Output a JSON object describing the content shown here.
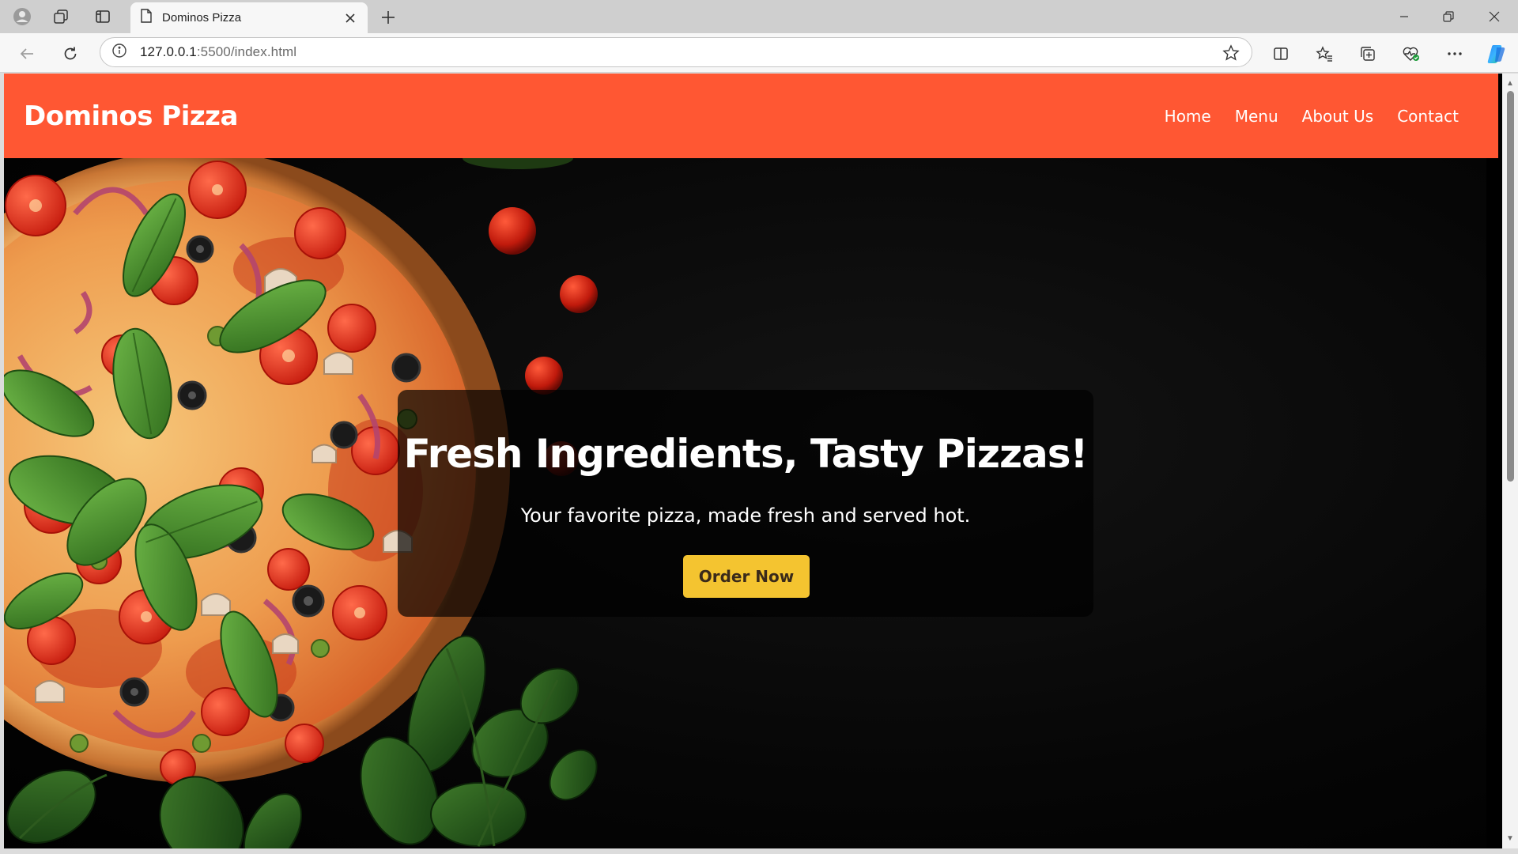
{
  "browser": {
    "tab_title": "Dominos Pizza",
    "url_host": "127.0.0.1",
    "url_rest": ":5500/index.html",
    "icons": {
      "profile": "profile-icon",
      "workspaces": "workspaces-icon",
      "tab_actions": "tab-actions-icon",
      "page": "page-icon",
      "close_tab": "close-icon",
      "new_tab": "plus-icon",
      "minimize": "minimize-icon",
      "restore": "restore-icon",
      "close_window": "close-icon",
      "back": "back-arrow-icon",
      "refresh": "refresh-icon",
      "site_info": "info-icon",
      "favorite": "star-icon",
      "split_screen": "split-screen-icon",
      "favorites": "favorites-icon",
      "collections": "collections-icon",
      "browser_essentials": "heart-pulse-icon",
      "more": "more-icon",
      "copilot": "copilot-icon"
    }
  },
  "site": {
    "brand": "Dominos Pizza",
    "nav": [
      {
        "label": "Home"
      },
      {
        "label": "Menu"
      },
      {
        "label": "About Us"
      },
      {
        "label": "Contact"
      }
    ],
    "hero": {
      "headline": "Fresh Ingredients, Tasty Pizzas!",
      "subline": "Your favorite pizza, made fresh and served hot.",
      "cta": "Order Now"
    }
  },
  "colors": {
    "header": "#ff5733",
    "cta": "#f4c430",
    "hero_bg": "#000000"
  }
}
